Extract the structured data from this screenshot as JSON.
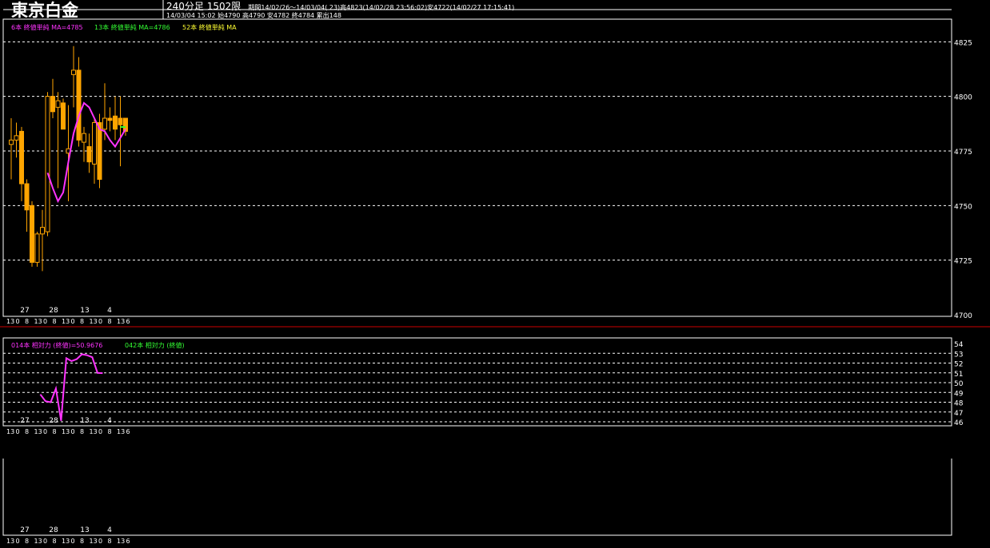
{
  "header": {
    "instrument": "東京白金",
    "line1_prefix": "240分足 1502限",
    "line1_rest": "期間14/02/26〜14/03/04( 23)高4823(14/02/28 23:56:02)安4722(14/02/27 17:15:41)",
    "line2": "14/03/04 15:02 始4790 高4790 安4782 終4784 累出148"
  },
  "colors": {
    "background": "#000000",
    "candle": "#FFA500",
    "ma6": "#FF33FF",
    "ma13": "#33FF33",
    "ma52": "#FFFF33",
    "grid": "#FFFFFF",
    "separator": "#CC0000"
  },
  "main_panel": {
    "legend": [
      {
        "text": "6本 終値単純 MA=4785",
        "color": "#FF33FF"
      },
      {
        "text": "13本 終値単純 MA=4786",
        "color": "#33FF33"
      },
      {
        "text": "52本 終値単純 MA",
        "color": "#FFFF33"
      }
    ],
    "y_ticks": [
      "4825",
      "4800",
      "4775",
      "4750",
      "4725",
      "4700"
    ],
    "date_labels": [
      "27",
      "28",
      "13",
      "4"
    ],
    "time_labels": [
      "13",
      "0",
      "8",
      "13",
      "0",
      "8",
      "13",
      "0",
      "8",
      "13",
      "0",
      "8",
      "13",
      "6"
    ]
  },
  "sub_panel": {
    "legend": [
      {
        "text": "014本 相対力 (終値)=50.9676",
        "color": "#FF33FF"
      },
      {
        "text": "042本 相対力 (終値)",
        "color": "#33FF33"
      }
    ],
    "y_ticks": [
      "54",
      "53",
      "52",
      "51",
      "50",
      "49",
      "48",
      "47",
      "46"
    ],
    "date_labels": [
      "27",
      "28",
      "13",
      "4"
    ],
    "time_labels": [
      "13",
      "0",
      "8",
      "13",
      "0",
      "8",
      "13",
      "0",
      "8",
      "13",
      "0",
      "8",
      "13",
      "6"
    ]
  },
  "third_panel": {
    "date_labels": [
      "27",
      "28",
      "13",
      "4"
    ],
    "time_labels": [
      "13",
      "0",
      "8",
      "13",
      "0",
      "8",
      "13",
      "0",
      "8",
      "13",
      "0",
      "8",
      "13",
      "6"
    ]
  },
  "chart_data": [
    {
      "type": "candlestick",
      "title": "東京白金 240分足 1502限",
      "ylim": [
        4700,
        4835
      ],
      "grid": true,
      "ohlc": [
        {
          "o": 4778,
          "h": 4790,
          "l": 4762,
          "c": 4780
        },
        {
          "o": 4780,
          "h": 4788,
          "l": 4772,
          "c": 4782
        },
        {
          "o": 4784,
          "h": 4786,
          "l": 4752,
          "c": 4760
        },
        {
          "o": 4760,
          "h": 4762,
          "l": 4738,
          "c": 4748
        },
        {
          "o": 4750,
          "h": 4752,
          "l": 4722,
          "c": 4724
        },
        {
          "o": 4724,
          "h": 4738,
          "l": 4722,
          "c": 4737
        },
        {
          "o": 4737,
          "h": 4748,
          "l": 4720,
          "c": 4740
        },
        {
          "o": 4738,
          "h": 4802,
          "l": 4736,
          "c": 4800
        },
        {
          "o": 4800,
          "h": 4808,
          "l": 4790,
          "c": 4793
        },
        {
          "o": 4795,
          "h": 4802,
          "l": 4758,
          "c": 4798
        },
        {
          "o": 4797,
          "h": 4799,
          "l": 4787,
          "c": 4785
        },
        {
          "o": 4774,
          "h": 4796,
          "l": 4752,
          "c": 4776
        },
        {
          "o": 4810,
          "h": 4823,
          "l": 4795,
          "c": 4812
        },
        {
          "o": 4812,
          "h": 4818,
          "l": 4777,
          "c": 4780
        },
        {
          "o": 4779,
          "h": 4786,
          "l": 4770,
          "c": 4783
        },
        {
          "o": 4777,
          "h": 4783,
          "l": 4765,
          "c": 4770
        },
        {
          "o": 4769,
          "h": 4790,
          "l": 4760,
          "c": 4788
        },
        {
          "o": 4788,
          "h": 4792,
          "l": 4758,
          "c": 4762
        },
        {
          "o": 4785,
          "h": 4806,
          "l": 4780,
          "c": 4790
        },
        {
          "o": 4790,
          "h": 4795,
          "l": 4784,
          "c": 4789
        },
        {
          "o": 4791,
          "h": 4800,
          "l": 4780,
          "c": 4785
        },
        {
          "o": 4790,
          "h": 4800,
          "l": 4768,
          "c": 4787
        },
        {
          "o": 4790,
          "h": 4790,
          "l": 4782,
          "c": 4784
        }
      ],
      "series": [
        {
          "name": "6本 終値単純 MA",
          "values": [
            null,
            null,
            null,
            null,
            null,
            null,
            null,
            4765,
            4758,
            4752,
            4756,
            4770,
            4783,
            4791,
            4797,
            4795,
            4790,
            4785,
            4784,
            4780,
            4777,
            4781,
            4785
          ]
        },
        {
          "name": "13本 終値単純 MA",
          "values": [
            null,
            null,
            null,
            null,
            null,
            null,
            null,
            null,
            null,
            null,
            null,
            null,
            null,
            null,
            null,
            null,
            null,
            null,
            null,
            null,
            null,
            4786,
            4786
          ]
        }
      ]
    },
    {
      "type": "line",
      "title": "014本 相対力 (終値)",
      "ylim": [
        46,
        54
      ],
      "grid": true,
      "series": [
        {
          "name": "014本 相対力 (終値)",
          "values": [
            null,
            null,
            null,
            null,
            null,
            null,
            null,
            null,
            null,
            null,
            null,
            null,
            null,
            null,
            null,
            null,
            48.8,
            48.1,
            48.0,
            49.4,
            46.1,
            52.5,
            52.2,
            52.4,
            52.9,
            52.8,
            52.6,
            51.0,
            50.97
          ]
        }
      ]
    }
  ]
}
